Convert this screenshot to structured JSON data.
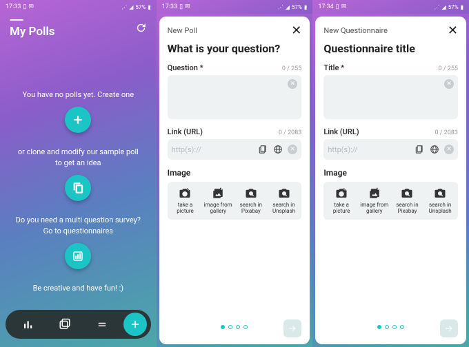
{
  "screen1": {
    "status": {
      "time": "17:33",
      "battery": "57%"
    },
    "title": "My Polls",
    "line1": "You have no polls yet. Create one",
    "line2": "or clone and modify our sample poll to get an idea",
    "line3": "Do you need a multi question survey? Go to questionnaires",
    "line4": "Be creative and have fun! :)"
  },
  "screen2": {
    "status": {
      "time": "17:33",
      "battery": "57%"
    },
    "header": "New Poll",
    "title": "What is your question?",
    "question_label": "Question *",
    "question_counter": "0 / 255",
    "link_label": "Link (URL)",
    "link_counter": "0 / 2083",
    "link_placeholder": "http(s)://",
    "image_label": "Image",
    "image_options": {
      "camera": "take a picture",
      "gallery": "image from gallery",
      "pixabay": "search in Pixabay",
      "unsplash": "search in Unsplash"
    }
  },
  "screen3": {
    "status": {
      "time": "17:34",
      "battery": "57%"
    },
    "header": "New Questionnaire",
    "title": "Questionnaire title",
    "title_label": "Title *",
    "title_counter": "0 / 255",
    "link_label": "Link (URL)",
    "link_counter": "0 / 2083",
    "link_placeholder": "http(s)://",
    "image_label": "Image",
    "image_options": {
      "camera": "take a picture",
      "gallery": "image from gallery",
      "pixabay": "search in Pixabay",
      "unsplash": "search in Unsplash"
    }
  }
}
